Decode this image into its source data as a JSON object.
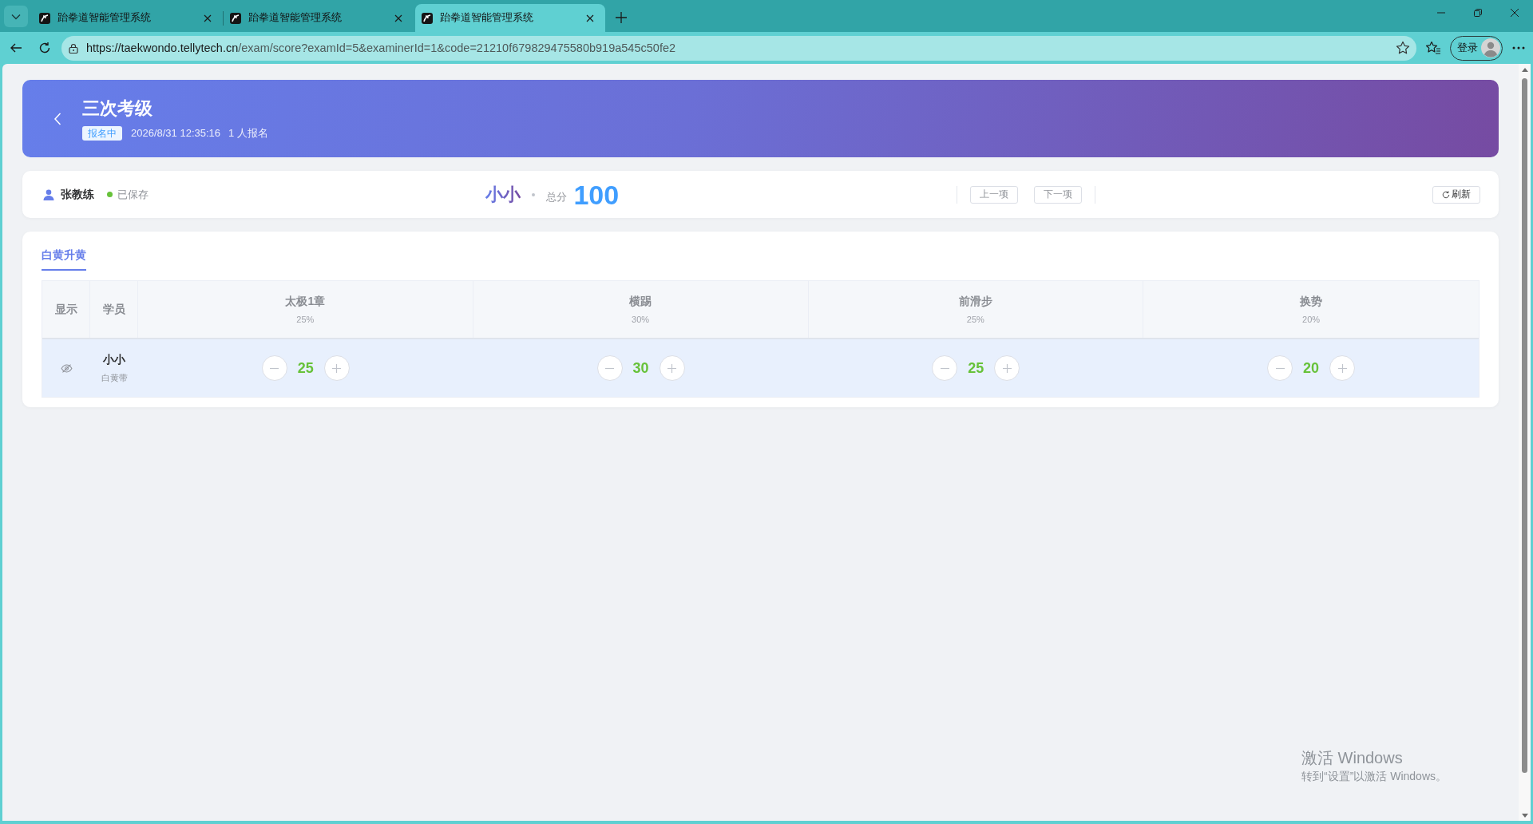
{
  "browser": {
    "tabs": [
      {
        "title": "跆拳道智能管理系统",
        "selected": false
      },
      {
        "title": "跆拳道智能管理系统",
        "selected": false
      },
      {
        "title": "跆拳道智能管理系统",
        "selected": true
      }
    ],
    "url": {
      "host": "https://taekwondo.tellytech.cn",
      "path": "/exam/score?examId=5&examinerId=1&code=21210f679829475580b919a545c50fe2"
    },
    "profile_button": "登录"
  },
  "header": {
    "title": "三次考级",
    "status_badge": "报名中",
    "date": "2026/8/31 12:35:16",
    "signup_count": "1 人报名"
  },
  "score_bar": {
    "examiner": "张教练",
    "saved": true,
    "save_status": "已保存",
    "student": "小小",
    "total_label": "总分",
    "total": "100",
    "prev_button": "上一项",
    "next_button": "下一项",
    "refresh_button": "刷新"
  },
  "tabs": [
    {
      "label": "白黄升黄",
      "selected": true
    }
  ],
  "table": {
    "columns": [
      {
        "title": "显示"
      },
      {
        "title": "学员"
      },
      {
        "title": "太极1章",
        "weight": "25%"
      },
      {
        "title": "横踢",
        "weight": "30%"
      },
      {
        "title": "前滑步",
        "weight": "25%"
      },
      {
        "title": "换势",
        "weight": "20%"
      }
    ],
    "rows": [
      {
        "selected": true,
        "visible": false,
        "name": "小小",
        "belt": "白黄带",
        "scores": [
          "25",
          "30",
          "25",
          "20"
        ]
      }
    ]
  },
  "os_notice": {
    "title": "激活 Windows",
    "text": "转到“设置”以激活 Windows。"
  }
}
